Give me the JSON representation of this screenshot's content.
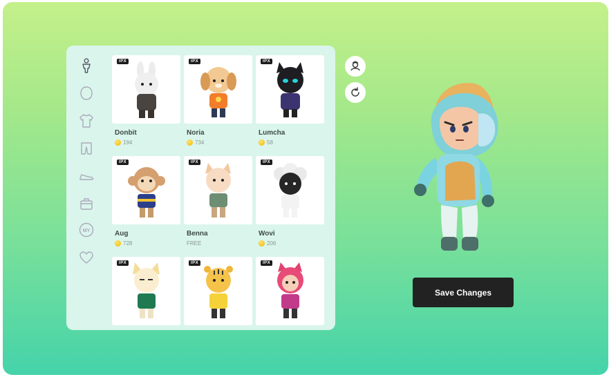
{
  "sidebar": {
    "categories": [
      {
        "name": "body",
        "label": ""
      },
      {
        "name": "head",
        "label": ""
      },
      {
        "name": "top",
        "label": ""
      },
      {
        "name": "bottom",
        "label": ""
      },
      {
        "name": "shoes",
        "label": ""
      },
      {
        "name": "bag",
        "label": ""
      },
      {
        "name": "my",
        "label": "MY"
      },
      {
        "name": "favorites",
        "label": ""
      }
    ]
  },
  "toolbar": {
    "avatar_icon": "avatar-icon",
    "reset_icon": "reset-icon"
  },
  "items": [
    {
      "badge": "IPX",
      "name": "Donbit",
      "price": "194",
      "currency": "coin"
    },
    {
      "badge": "IPX",
      "name": "Noria",
      "price": "734",
      "currency": "coin"
    },
    {
      "badge": "IPX",
      "name": "Lumcha",
      "price": "58",
      "currency": "coin"
    },
    {
      "badge": "IPX",
      "name": "Aug",
      "price": "728",
      "currency": "coin"
    },
    {
      "badge": "IPX",
      "name": "Benna",
      "price": "FREE",
      "currency": ""
    },
    {
      "badge": "IPX",
      "name": "Wovi",
      "price": "206",
      "currency": "coin"
    },
    {
      "badge": "IPX",
      "name": "",
      "price": "",
      "currency": ""
    },
    {
      "badge": "IPX",
      "name": "",
      "price": "",
      "currency": ""
    },
    {
      "badge": "IPX",
      "name": "",
      "price": "",
      "currency": ""
    }
  ],
  "actions": {
    "save_label": "Save Changes"
  },
  "colors": {
    "panel": "#daf5ec",
    "accent_dark": "#222222",
    "coin": "#f4b400"
  }
}
